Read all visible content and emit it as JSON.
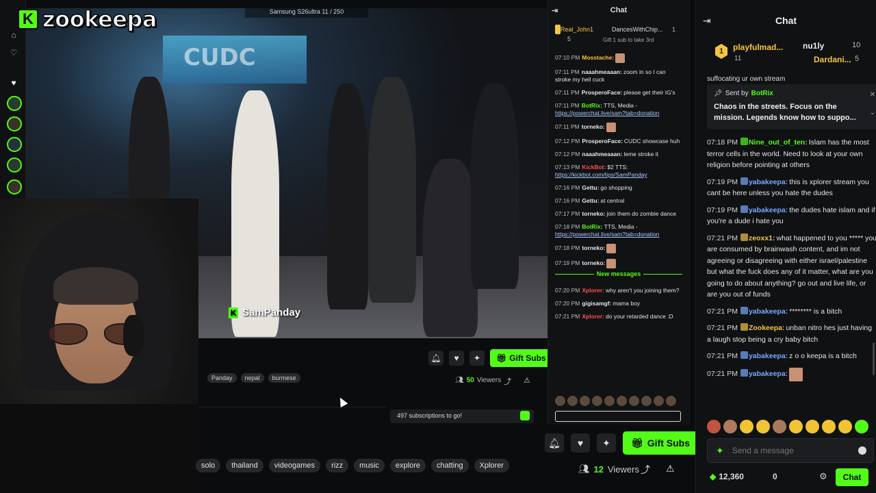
{
  "brand": {
    "logo_letter": "K",
    "logo_text": "zookeepa"
  },
  "inner_stream": {
    "device_caption": "Samsung S26ultra 11 / 250",
    "video_sign": "CUDC",
    "streamer_tag": "SamPanday",
    "gift_subs_label": "Gift Subs",
    "tags": [
      "Panday",
      "nepal",
      "burmese"
    ],
    "viewers_count": "50",
    "viewers_word": "Viewers",
    "subs_goal_text": "497 subscriptions to go!"
  },
  "inner_chat": {
    "title": "Chat",
    "gifters": {
      "top1": "Real_John1",
      "top1_count": "5",
      "top2": "DancesWithChip...",
      "top2_count": "1",
      "cta": "Gift 1 sub to take 3rd"
    },
    "new_messages_label": "New messages",
    "messages": [
      {
        "time": "07:10 PM",
        "user": "Mosstache:",
        "color": "#f4c542",
        "text": ""
      },
      {
        "time": "07:11 PM",
        "user": "naaahmeaaan:",
        "color": "#e6e6e6",
        "text": "zoom in so I can stroke my hell cuck"
      },
      {
        "time": "07:11 PM",
        "user": "ProsperoFace:",
        "color": "#e6e6e6",
        "text": "please get their IG's"
      },
      {
        "time": "07:11 PM",
        "user": "BotRix:",
        "color": "#53fc18",
        "text": "TTS, Media -",
        "link": "https://powerchat.live/sam?tab=donation"
      },
      {
        "time": "07:11 PM",
        "user": "torneko:",
        "color": "#e6e6e6",
        "text": ""
      },
      {
        "time": "07:12 PM",
        "user": "ProsperoFace:",
        "color": "#e6e6e6",
        "text": "CUDC showcase huh"
      },
      {
        "time": "07:12 PM",
        "user": "naaahmeaaan:",
        "color": "#e6e6e6",
        "text": "leme stroke it"
      },
      {
        "time": "07:13 PM",
        "user": "KickBot:",
        "color": "#ff4d4d",
        "text": "$2 TTS:",
        "link": "https://kickbot.com/tips/SamPanday"
      },
      {
        "time": "07:16 PM",
        "user": "Gettu:",
        "color": "#e6e6e6",
        "text": "go shopping"
      },
      {
        "time": "07:16 PM",
        "user": "Gettu:",
        "color": "#e6e6e6",
        "text": "at central"
      },
      {
        "time": "07:17 PM",
        "user": "torneko:",
        "color": "#e6e6e6",
        "text": "join them do zombie dance"
      },
      {
        "time": "07:18 PM",
        "user": "BotRix:",
        "color": "#53fc18",
        "text": "TTS, Media -",
        "link": "https://powerchat.live/sam?tab=donation"
      },
      {
        "time": "07:18 PM",
        "user": "torneko:",
        "color": "#e6e6e6",
        "text": ""
      },
      {
        "time": "07:19 PM",
        "user": "torneko:",
        "color": "#e6e6e6",
        "text": ""
      }
    ],
    "new_messages": [
      {
        "time": "07:20 PM",
        "user": "Xplorer:",
        "color": "#ff4d4d",
        "text": "why aren't you joining them?"
      },
      {
        "time": "07:20 PM",
        "user": "gigisamgf:",
        "color": "#e6e6e6",
        "text": "mama boy"
      },
      {
        "time": "07:21 PM",
        "user": "Xplorer:",
        "color": "#ff4d4d",
        "text": "do your retarded dance :D"
      }
    ]
  },
  "actions": {
    "gift_subs_label": "Gift Subs",
    "tags": [
      "solo",
      "thailand",
      "videogames",
      "rizz",
      "music",
      "explore",
      "chatting",
      "Xplorer"
    ],
    "viewers_count": "12",
    "viewers_word": "Viewers"
  },
  "chat": {
    "title": "Chat",
    "top_gifters": {
      "rank": "1",
      "u1": "playfulmad...",
      "c1": "11",
      "u2": "nu1ly",
      "c2": "10",
      "u3": "Dardani...",
      "c3": "5"
    },
    "cut_line": "suffocating ur own stream",
    "pinned": {
      "sent_by_label": "Sent by",
      "sender": "BotRix",
      "body": "Chaos in the streets. Focus on the mission. Legends know how to suppo..."
    },
    "messages": [
      {
        "time": "07:18 PM",
        "user": "Nine_out_of_ten:",
        "color": "#53fc18",
        "text": "Islam has the most terror cells in the world. Need to look at your own religion before pointing at others"
      },
      {
        "time": "07:19 PM",
        "user": "yabakeepa:",
        "color": "#7aa7ff",
        "text": "this is xplorer stream you cant be here unless you hate the dudes"
      },
      {
        "time": "07:19 PM",
        "user": "yabakeepa:",
        "color": "#7aa7ff",
        "text": "the dudes hate islam and if you're a dude i hate you"
      },
      {
        "time": "07:21 PM",
        "user": "zeoxx1:",
        "color": "#f4c542",
        "text": "what happened to you ***** you are consumed by brainwash content, and im not agreeing or disagreeing with either israel/palestine but what the fuck does any of it matter, what are you going to do about anything? go out and live life, or are you out of funds"
      },
      {
        "time": "07:21 PM",
        "user": "yabakeepa:",
        "color": "#7aa7ff",
        "text": "******** is a bitch"
      },
      {
        "time": "07:21 PM",
        "user": "Zookeepa:",
        "color": "#f4c542",
        "text": "unban nitro hes just having a laugh stop being a cry baby bitch"
      },
      {
        "time": "07:21 PM",
        "user": "yabakeepa:",
        "color": "#7aa7ff",
        "text": "z o o keepa is a bitch"
      },
      {
        "time": "07:21 PM",
        "user": "yabakeepa:",
        "color": "#7aa7ff",
        "text": ""
      }
    ],
    "send_placeholder": "Send a message",
    "points": "12,360",
    "zero": "0",
    "chat_button": "Chat"
  }
}
